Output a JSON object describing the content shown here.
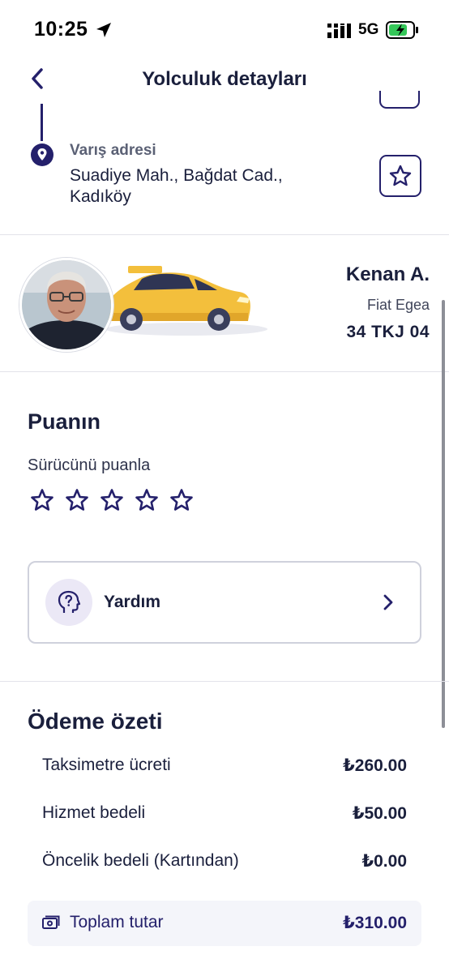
{
  "status_bar": {
    "time": "10:25",
    "network": "5G"
  },
  "header": {
    "title": "Yolculuk detayları"
  },
  "route": {
    "destination_label": "Varış adresi",
    "destination_address": "Suadiye Mah., Bağdat Cad., Kadıköy"
  },
  "driver": {
    "name": "Kenan A.",
    "car_model": "Fiat Egea",
    "plate": "34 TKJ 04"
  },
  "rating": {
    "title": "Puanın",
    "subtitle": "Sürücünü puanla",
    "max_stars": 5,
    "current": 0
  },
  "help": {
    "label": "Yardım"
  },
  "payment": {
    "title": "Ödeme özeti",
    "items": [
      {
        "label": "Taksimetre ücreti",
        "amount": "₺260.00"
      },
      {
        "label": "Hizmet bedeli",
        "amount": "₺50.00"
      },
      {
        "label": "Öncelik bedeli (Kartından)",
        "amount": "₺0.00"
      }
    ],
    "total_label": "Toplam tutar",
    "total_amount": "₺310.00"
  },
  "colors": {
    "primary": "#24206b",
    "text": "#1a1f3c",
    "taxi": "#f3bf3c",
    "help_bg": "#ebe8f6"
  }
}
